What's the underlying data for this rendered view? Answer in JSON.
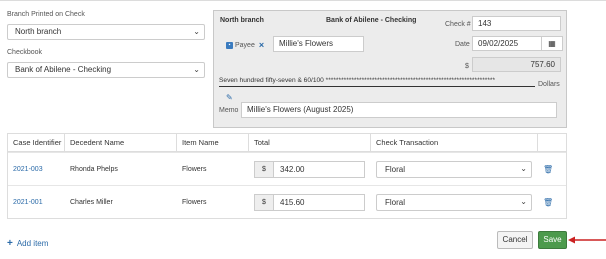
{
  "branch_field": {
    "label": "Branch Printed on Check",
    "value": "North branch"
  },
  "checkbook_field": {
    "label": "Checkbook",
    "value": "Bank of Abilene - Checking"
  },
  "check": {
    "branch": "North branch",
    "bank": "Bank of Abilene - Checking",
    "check_number_label": "Check #",
    "check_number": "143",
    "payee_label": "Payee",
    "payee": "Millie's Flowers",
    "date_label": "Date",
    "date": "09/02/2025",
    "amount_symbol": "$",
    "amount": "757.60",
    "amount_words": "Seven hundred fifty-seven & 60/100 ******************************************************************",
    "dollars_label": "Dollars",
    "memo_label": "Memo",
    "memo": "Millie's Flowers (August 2025)"
  },
  "table": {
    "headers": [
      "Case Identifier",
      "Decedent Name",
      "Item Name",
      "Total",
      "Check Transaction"
    ],
    "rows": [
      {
        "case": "2021-003",
        "decedent": "Rhonda Phelps",
        "item": "Flowers",
        "currency": "$",
        "total": "342.00",
        "transaction": "Floral"
      },
      {
        "case": "2021-001",
        "decedent": "Charles Miller",
        "item": "Flowers",
        "currency": "$",
        "total": "415.60",
        "transaction": "Floral"
      }
    ]
  },
  "actions": {
    "add_item": "Add item",
    "cancel": "Cancel",
    "save": "Save"
  },
  "colors": {
    "link": "#2a6aa8",
    "save": "#4c9a4c",
    "arrow": "#cc2222",
    "panel": "#ececec"
  }
}
